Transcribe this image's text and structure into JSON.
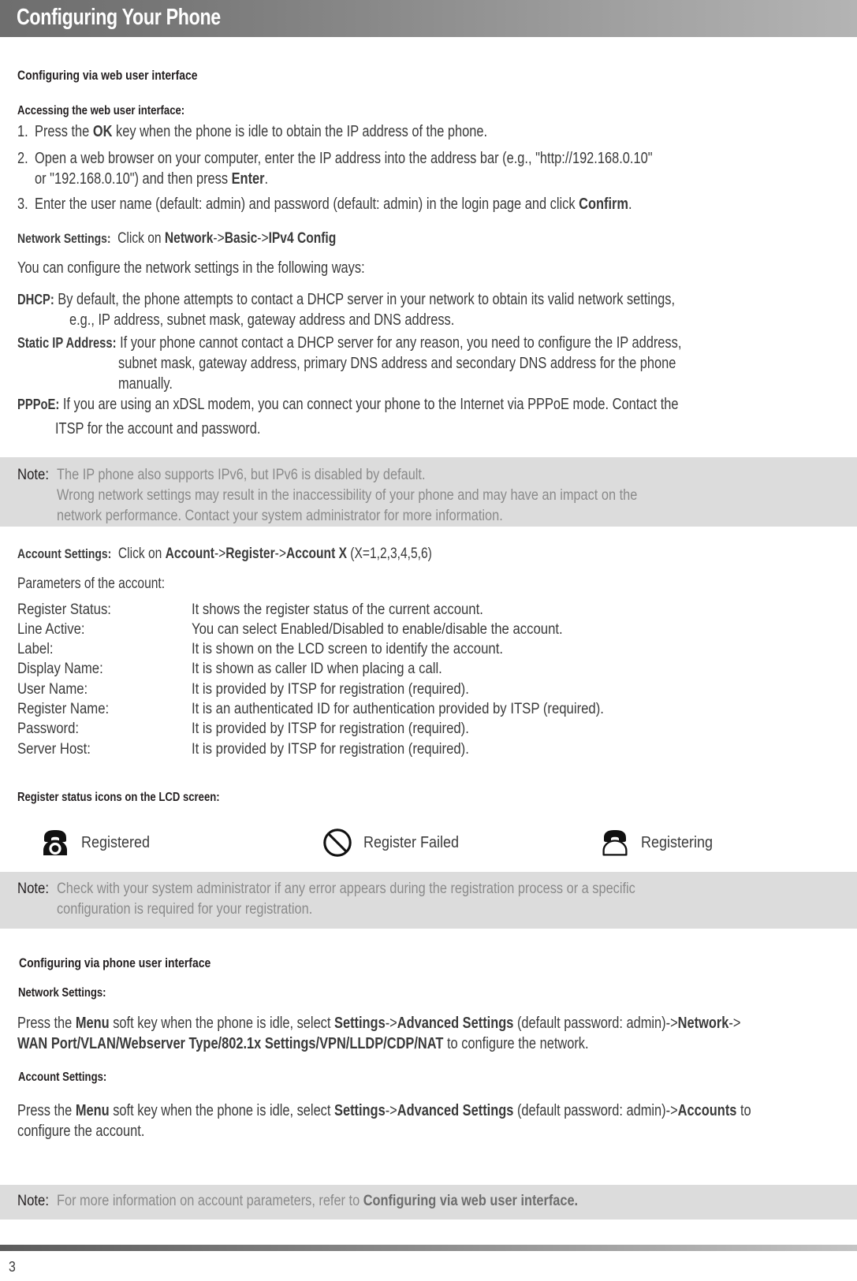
{
  "header": {
    "title": "Configuring Your Phone"
  },
  "web_ui": {
    "section_title": "Configuring via web user interface",
    "access_heading": "Accessing the web user interface:",
    "steps": [
      {
        "num": "1.",
        "parts": [
          {
            "t": "Press the ",
            "b": false
          },
          {
            "t": "OK",
            "b": true
          },
          {
            "t": " key when the phone is idle to obtain the IP address of the phone.",
            "b": false
          }
        ]
      },
      {
        "num": "2.",
        "parts": [
          {
            "t": "Open a web browser on your computer, enter the IP address into the address bar (e.g., \"http://192.168.0.10\"",
            "b": false
          }
        ],
        "parts2": [
          {
            "t": "or \"192.168.0.10\") and then press ",
            "b": false
          },
          {
            "t": "Enter",
            "b": true
          },
          {
            "t": ".",
            "b": false
          }
        ]
      },
      {
        "num": "3.",
        "parts": [
          {
            "t": "Enter the user name (default: admin) and password (default: admin) in the login page and click ",
            "b": false
          },
          {
            "t": "Confirm",
            "b": true
          },
          {
            "t": ".",
            "b": false
          }
        ]
      }
    ],
    "network_settings_label": "Network Settings:",
    "network_settings_path_prefix": "Click on ",
    "network_settings_path": [
      {
        "t": "Network",
        "b": true
      },
      {
        "t": "->",
        "b": false
      },
      {
        "t": "Basic",
        "b": true
      },
      {
        "t": "->",
        "b": false
      },
      {
        "t": "IPv4 Config",
        "b": true
      }
    ],
    "network_intro": "You can configure the network settings in the following ways:",
    "methods": [
      {
        "term": "DHCP:",
        "lines": [
          "By default, the phone attempts to contact a DHCP server in your network to obtain its valid network settings,",
          "e.g., IP address, subnet mask, gateway address and DNS address."
        ]
      },
      {
        "term": "Static IP Address:",
        "lines": [
          "If your phone cannot contact a DHCP server for any reason, you need to configure the IP address,",
          "subnet mask, gateway address, primary DNS address and secondary DNS address for the phone",
          "manually."
        ]
      },
      {
        "term": "PPPoE:",
        "lines": [
          "If you are using an xDSL modem, you can connect your phone to the Internet via PPPoE mode. Contact the",
          "ITSP for the account and password."
        ]
      }
    ],
    "note1": {
      "label": "Note:",
      "lines": [
        "The IP phone also supports IPv6, but IPv6 is disabled by default.",
        "Wrong network settings may result in the inaccessibility of your phone and may have an impact on the",
        "network performance. Contact your system administrator for more information."
      ]
    },
    "account_settings_label": "Account Settings:",
    "account_settings_prefix": "Click on ",
    "account_settings_path": [
      {
        "t": "Account",
        "b": true
      },
      {
        "t": "->",
        "b": false
      },
      {
        "t": "Register",
        "b": true
      },
      {
        "t": "->",
        "b": false
      },
      {
        "t": "Account X",
        "b": true
      },
      {
        "t": " (X=1,2,3,4,5,6)",
        "b": false
      }
    ],
    "params_heading": "Parameters of the account:",
    "params": [
      {
        "term": "Register Status:",
        "desc": "It shows the register status of the current account."
      },
      {
        "term": "Line Active:",
        "desc": "You can select Enabled/Disabled to enable/disable the account."
      },
      {
        "term": "Label:",
        "desc": "It is shown on the LCD screen to identify the account."
      },
      {
        "term": "Display Name:",
        "desc": "It is shown as caller ID when placing a call."
      },
      {
        "term": "User Name:",
        "desc": "It is provided by ITSP for registration (required)."
      },
      {
        "term": "Register Name:",
        "desc": "It is an authenticated ID for authentication provided by ITSP (required)."
      },
      {
        "term": "Password:",
        "desc": "It is provided by ITSP for registration (required)."
      },
      {
        "term": "Server Host:",
        "desc": "It is provided by ITSP for registration (required)."
      }
    ],
    "icons_heading": "Register status icons on the LCD screen:",
    "status_icons": [
      {
        "icon": "phone-registered-icon",
        "label": "Registered"
      },
      {
        "icon": "register-failed-icon",
        "label": "Register Failed"
      },
      {
        "icon": "phone-registering-icon",
        "label": "Registering"
      }
    ],
    "note2": {
      "label": "Note:",
      "lines": [
        "Check with your system administrator if any error appears during the registration process or a specific",
        "configuration is required for your registration."
      ]
    }
  },
  "phone_ui": {
    "section_title": "Configuring via phone user interface",
    "network_settings_label": "Network Settings:",
    "network_line1": [
      {
        "t": "Press the ",
        "b": false
      },
      {
        "t": "Menu",
        "b": true
      },
      {
        "t": " soft key when the phone is idle, select ",
        "b": false
      },
      {
        "t": "Settings",
        "b": true
      },
      {
        "t": "->",
        "b": false
      },
      {
        "t": "Advanced Settings",
        "b": true
      },
      {
        "t": " (default password: admin)->",
        "b": false
      },
      {
        "t": "Network",
        "b": true
      },
      {
        "t": "->",
        "b": false
      }
    ],
    "network_line2": [
      {
        "t": "WAN Port/VLAN/Webserver Type/802.1x  Settings/VPN/LLDP/CDP/NAT",
        "b": true
      },
      {
        "t": " to configure the network.",
        "b": false
      }
    ],
    "account_settings_label": "Account Settings:",
    "account_line1": [
      {
        "t": "Press the ",
        "b": false
      },
      {
        "t": "Menu",
        "b": true
      },
      {
        "t": " soft key when the phone is idle, select ",
        "b": false
      },
      {
        "t": "Settings",
        "b": true
      },
      {
        "t": "->",
        "b": false
      },
      {
        "t": "Advanced Settings",
        "b": true
      },
      {
        "t": " (default password: admin)->",
        "b": false
      },
      {
        "t": "Accounts",
        "b": true
      },
      {
        "t": " to",
        "b": false
      }
    ],
    "account_line2": [
      {
        "t": "configure the account.",
        "b": false
      }
    ],
    "note3": {
      "label": "Note:",
      "prefix": "For more information on account parameters, refer to ",
      "bold": "Configuring via web user interface."
    }
  },
  "footer": {
    "page_number": "3"
  },
  "colors": {
    "header_gradient_start": "#6e6e6e",
    "header_gradient_end": "#b4b4b4",
    "note_background": "#dcdcdc",
    "note_text": "#8a8a8a",
    "body_text": "#3a3a3a"
  }
}
